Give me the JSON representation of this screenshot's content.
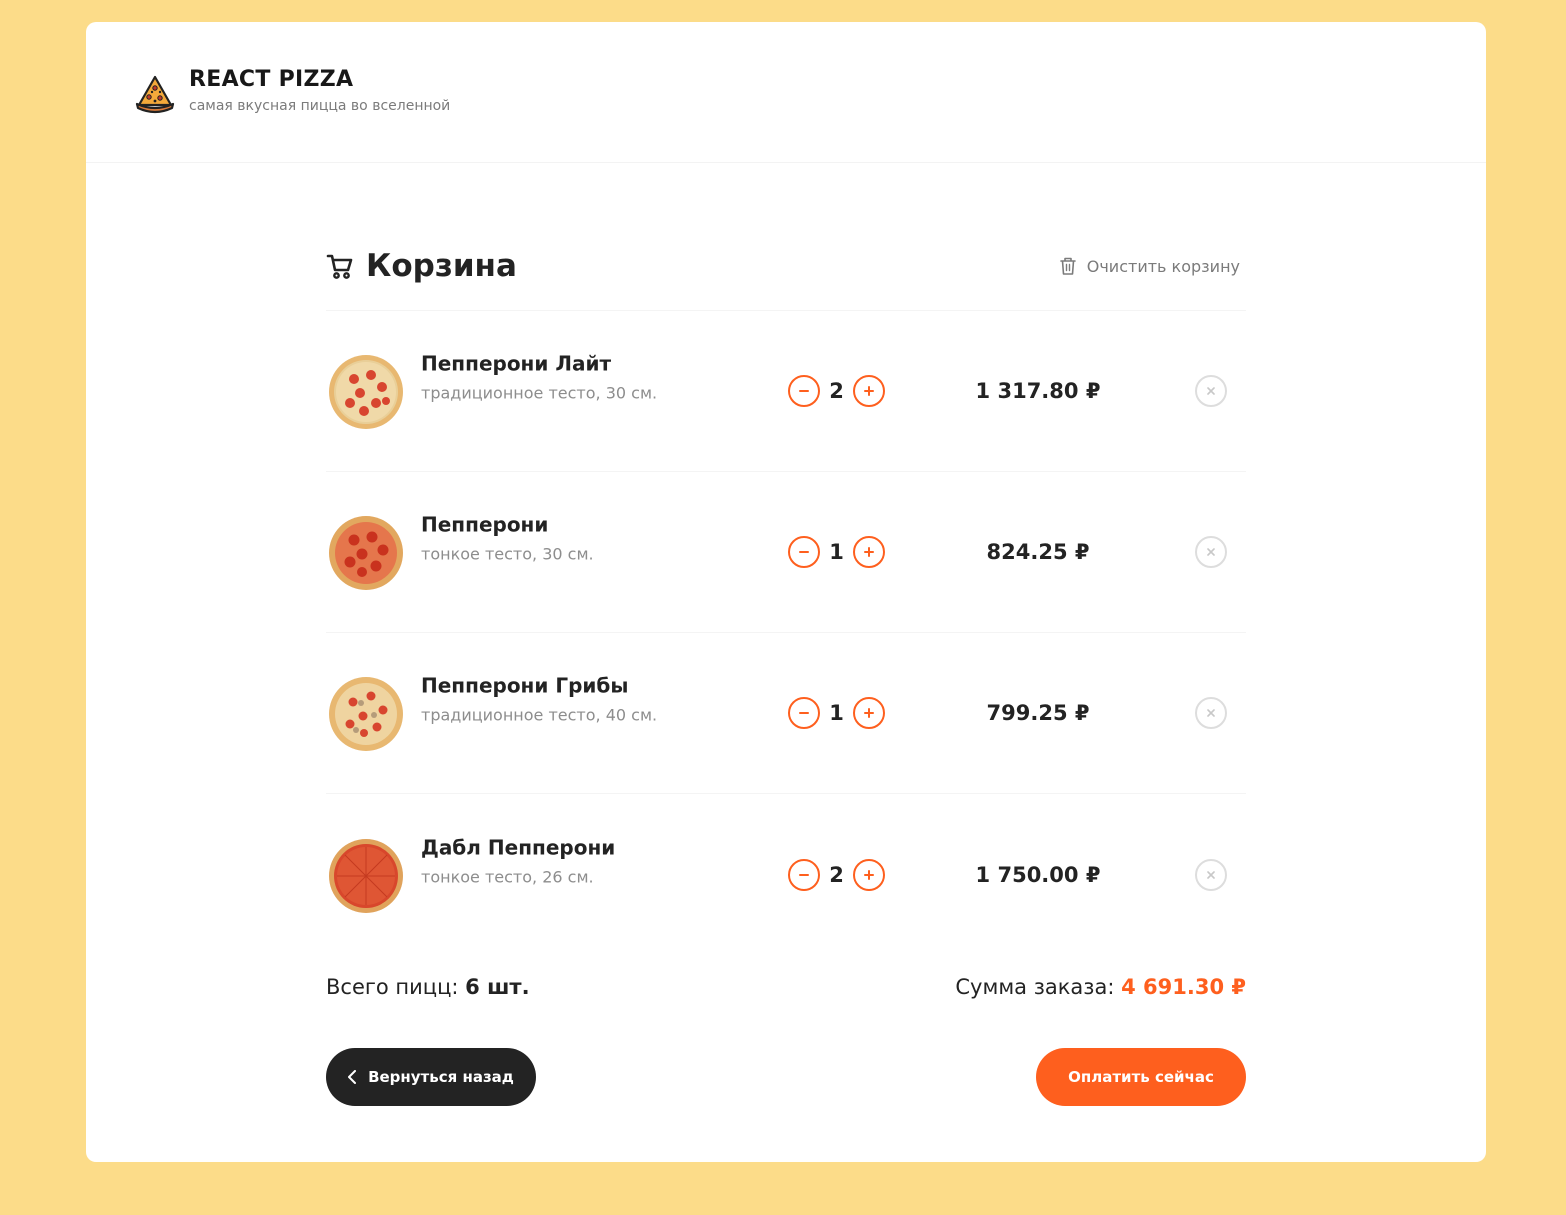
{
  "brand": {
    "title": "REACT PIZZA",
    "subtitle": "самая вкусная пицца во вселенной"
  },
  "cart": {
    "title": "Корзина",
    "clear_label": "Очистить корзину",
    "items": [
      {
        "name": "Пепперони Лайт",
        "desc": "традиционное тесто, 30 см.",
        "count": "2",
        "price": "1 317.80 ₽"
      },
      {
        "name": "Пепперони",
        "desc": "тонкое тесто, 30 см.",
        "count": "1",
        "price": "824.25 ₽"
      },
      {
        "name": "Пепперони Грибы",
        "desc": "традиционное тесто, 40 см.",
        "count": "1",
        "price": "799.25 ₽"
      },
      {
        "name": "Дабл Пепперони",
        "desc": "тонкое тесто, 26 см.",
        "count": "2",
        "price": "1 750.00 ₽"
      }
    ]
  },
  "summary": {
    "count_label": "Всего пицц:",
    "count_value": "6 шт.",
    "sum_label": "Сумма заказа:",
    "sum_value": "4 691.30 ₽"
  },
  "buttons": {
    "back": "Вернуться назад",
    "pay": "Оплатить сейчас"
  },
  "colors": {
    "accent": "#fe5f1e",
    "background": "#fcdc89",
    "dark": "#232323"
  }
}
